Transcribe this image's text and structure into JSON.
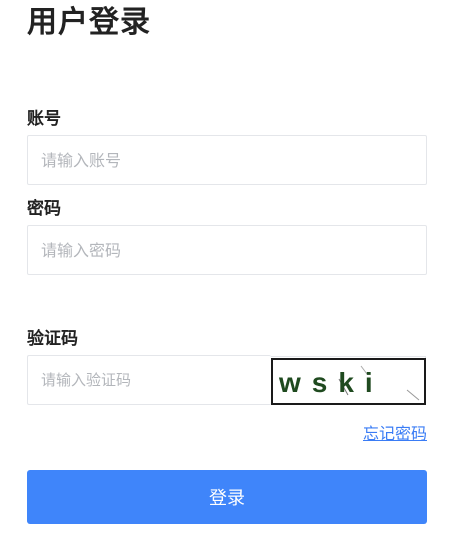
{
  "page": {
    "title": "用户登录"
  },
  "form": {
    "account": {
      "label": "账号",
      "placeholder": "请输入账号",
      "value": ""
    },
    "password": {
      "label": "密码",
      "placeholder": "请输入密码",
      "value": ""
    },
    "captcha": {
      "label": "验证码",
      "placeholder": "请输入验证码",
      "value": "",
      "image_text": "wski",
      "image_text_color": "#1f4a1f"
    },
    "forgot_password": "忘记密码",
    "login_button": "登录"
  },
  "colors": {
    "primary": "#3f85fa",
    "link": "#3a7cf5",
    "input_border": "#e4e6ea",
    "placeholder": "#b3b6bb",
    "text": "#222222"
  }
}
